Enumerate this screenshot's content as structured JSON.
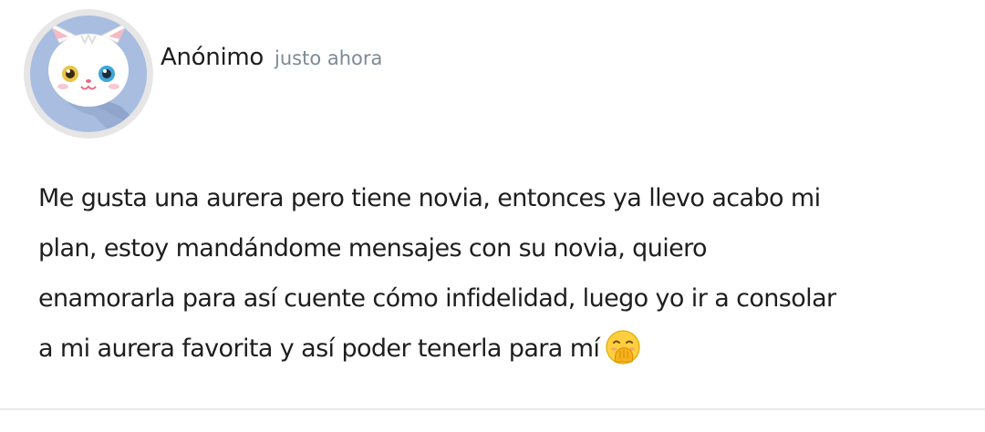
{
  "post": {
    "author": "Anónimo",
    "timestamp": "justo ahora",
    "avatar_icon": "white-cat-avatar-icon",
    "emoji_icon": "hand-over-mouth-emoji-icon",
    "body_lines": [
      "Me gusta una aurera pero tiene novia, entonces ya llevo acabo mi",
      "plan, estoy mandándome mensajes con su novia, quiero",
      "enamorarla para así cuente cómo infidelidad, luego yo ir a consolar",
      "a mi aurera favorita y así poder tenerla para mí"
    ]
  },
  "colors": {
    "avatar_bg": "#a8bde0",
    "timestamp": "#7d8a96",
    "text": "#1e1e1e",
    "divider": "#e9e9e9"
  }
}
